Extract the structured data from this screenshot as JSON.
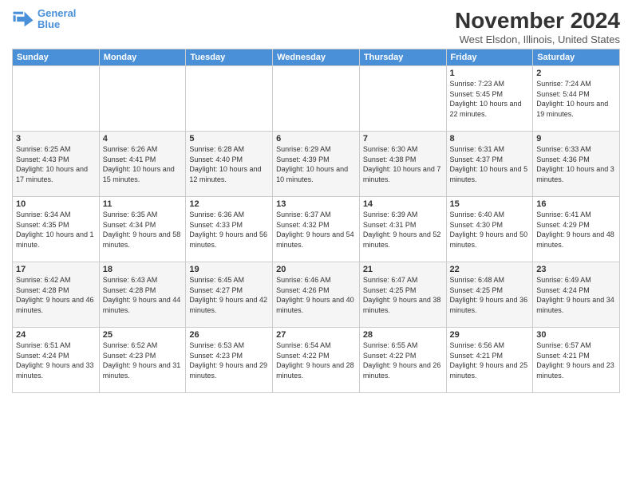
{
  "header": {
    "logo_line1": "General",
    "logo_line2": "Blue",
    "title": "November 2024",
    "location": "West Elsdon, Illinois, United States"
  },
  "days_of_week": [
    "Sunday",
    "Monday",
    "Tuesday",
    "Wednesday",
    "Thursday",
    "Friday",
    "Saturday"
  ],
  "weeks": [
    [
      {
        "day": "",
        "info": ""
      },
      {
        "day": "",
        "info": ""
      },
      {
        "day": "",
        "info": ""
      },
      {
        "day": "",
        "info": ""
      },
      {
        "day": "",
        "info": ""
      },
      {
        "day": "1",
        "info": "Sunrise: 7:23 AM\nSunset: 5:45 PM\nDaylight: 10 hours and 22 minutes."
      },
      {
        "day": "2",
        "info": "Sunrise: 7:24 AM\nSunset: 5:44 PM\nDaylight: 10 hours and 19 minutes."
      }
    ],
    [
      {
        "day": "3",
        "info": "Sunrise: 6:25 AM\nSunset: 4:43 PM\nDaylight: 10 hours and 17 minutes."
      },
      {
        "day": "4",
        "info": "Sunrise: 6:26 AM\nSunset: 4:41 PM\nDaylight: 10 hours and 15 minutes."
      },
      {
        "day": "5",
        "info": "Sunrise: 6:28 AM\nSunset: 4:40 PM\nDaylight: 10 hours and 12 minutes."
      },
      {
        "day": "6",
        "info": "Sunrise: 6:29 AM\nSunset: 4:39 PM\nDaylight: 10 hours and 10 minutes."
      },
      {
        "day": "7",
        "info": "Sunrise: 6:30 AM\nSunset: 4:38 PM\nDaylight: 10 hours and 7 minutes."
      },
      {
        "day": "8",
        "info": "Sunrise: 6:31 AM\nSunset: 4:37 PM\nDaylight: 10 hours and 5 minutes."
      },
      {
        "day": "9",
        "info": "Sunrise: 6:33 AM\nSunset: 4:36 PM\nDaylight: 10 hours and 3 minutes."
      }
    ],
    [
      {
        "day": "10",
        "info": "Sunrise: 6:34 AM\nSunset: 4:35 PM\nDaylight: 10 hours and 1 minute."
      },
      {
        "day": "11",
        "info": "Sunrise: 6:35 AM\nSunset: 4:34 PM\nDaylight: 9 hours and 58 minutes."
      },
      {
        "day": "12",
        "info": "Sunrise: 6:36 AM\nSunset: 4:33 PM\nDaylight: 9 hours and 56 minutes."
      },
      {
        "day": "13",
        "info": "Sunrise: 6:37 AM\nSunset: 4:32 PM\nDaylight: 9 hours and 54 minutes."
      },
      {
        "day": "14",
        "info": "Sunrise: 6:39 AM\nSunset: 4:31 PM\nDaylight: 9 hours and 52 minutes."
      },
      {
        "day": "15",
        "info": "Sunrise: 6:40 AM\nSunset: 4:30 PM\nDaylight: 9 hours and 50 minutes."
      },
      {
        "day": "16",
        "info": "Sunrise: 6:41 AM\nSunset: 4:29 PM\nDaylight: 9 hours and 48 minutes."
      }
    ],
    [
      {
        "day": "17",
        "info": "Sunrise: 6:42 AM\nSunset: 4:28 PM\nDaylight: 9 hours and 46 minutes."
      },
      {
        "day": "18",
        "info": "Sunrise: 6:43 AM\nSunset: 4:28 PM\nDaylight: 9 hours and 44 minutes."
      },
      {
        "day": "19",
        "info": "Sunrise: 6:45 AM\nSunset: 4:27 PM\nDaylight: 9 hours and 42 minutes."
      },
      {
        "day": "20",
        "info": "Sunrise: 6:46 AM\nSunset: 4:26 PM\nDaylight: 9 hours and 40 minutes."
      },
      {
        "day": "21",
        "info": "Sunrise: 6:47 AM\nSunset: 4:25 PM\nDaylight: 9 hours and 38 minutes."
      },
      {
        "day": "22",
        "info": "Sunrise: 6:48 AM\nSunset: 4:25 PM\nDaylight: 9 hours and 36 minutes."
      },
      {
        "day": "23",
        "info": "Sunrise: 6:49 AM\nSunset: 4:24 PM\nDaylight: 9 hours and 34 minutes."
      }
    ],
    [
      {
        "day": "24",
        "info": "Sunrise: 6:51 AM\nSunset: 4:24 PM\nDaylight: 9 hours and 33 minutes."
      },
      {
        "day": "25",
        "info": "Sunrise: 6:52 AM\nSunset: 4:23 PM\nDaylight: 9 hours and 31 minutes."
      },
      {
        "day": "26",
        "info": "Sunrise: 6:53 AM\nSunset: 4:23 PM\nDaylight: 9 hours and 29 minutes."
      },
      {
        "day": "27",
        "info": "Sunrise: 6:54 AM\nSunset: 4:22 PM\nDaylight: 9 hours and 28 minutes."
      },
      {
        "day": "28",
        "info": "Sunrise: 6:55 AM\nSunset: 4:22 PM\nDaylight: 9 hours and 26 minutes."
      },
      {
        "day": "29",
        "info": "Sunrise: 6:56 AM\nSunset: 4:21 PM\nDaylight: 9 hours and 25 minutes."
      },
      {
        "day": "30",
        "info": "Sunrise: 6:57 AM\nSunset: 4:21 PM\nDaylight: 9 hours and 23 minutes."
      }
    ]
  ]
}
